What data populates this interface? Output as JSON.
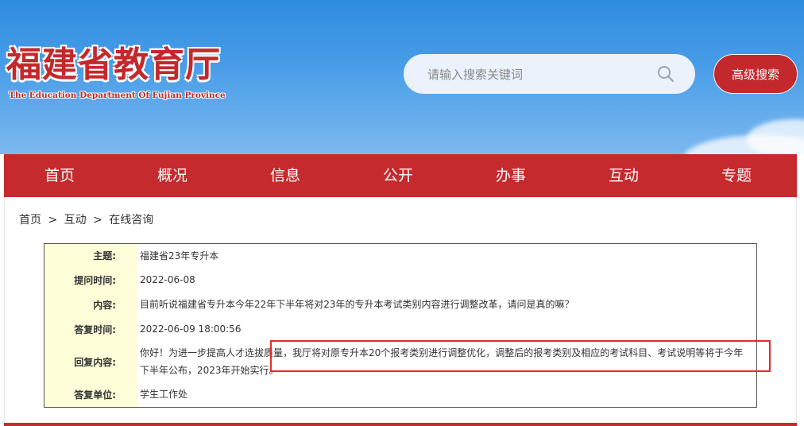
{
  "header": {
    "logo_cn": "福建省教育厅",
    "logo_en": "The Education Department Of Fujian Province",
    "search_placeholder": "请输入搜索关键词",
    "advanced_search": "高级搜索"
  },
  "nav": {
    "items": [
      "首页",
      "概况",
      "信息",
      "公开",
      "办事",
      "互动",
      "专题"
    ]
  },
  "breadcrumb": {
    "items": [
      "首页",
      ">",
      "互动",
      ">",
      "在线咨询"
    ]
  },
  "consult": {
    "rows": [
      {
        "label": "主题:",
        "value": "福建省23年专升本"
      },
      {
        "label": "提问时间:",
        "value": "2022-06-08"
      },
      {
        "label": "内容:",
        "value": "目前听说福建省专升本今年22年下半年将对23年的专升本考试类别内容进行调整改革，请问是真的嘛？"
      },
      {
        "label": "答复时间:",
        "value": "2022-06-09 18:00:56"
      },
      {
        "label": "回复内容:",
        "value": "你好！为进一步提高人才选拔质量，我厅将对原专升本20个报考类别进行调整优化，调整后的报考类别及相应的考试科目、考试说明等将于今年下半年公布，2023年开始实行。"
      },
      {
        "label": "答复单位:",
        "value": "学生工作处"
      }
    ]
  },
  "colors": {
    "brand_red": "#c52a2e",
    "label_bg": "#fefed8",
    "highlight": "#e22c2c"
  }
}
